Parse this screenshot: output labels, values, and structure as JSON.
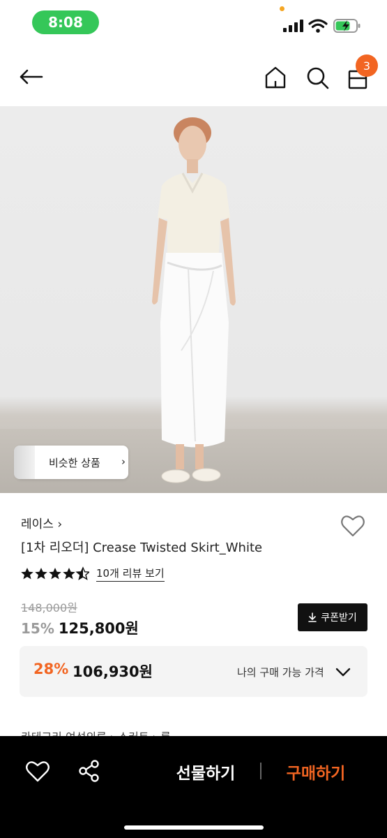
{
  "status_bar": {
    "time": "8:08"
  },
  "nav": {
    "cart_count": "3"
  },
  "hero": {
    "similar_label": "비슷한 상품",
    "similar_chevron": "›"
  },
  "product": {
    "brand": "레이스 ›",
    "title": "[1차 리오더] Crease Twisted Skirt_White",
    "rating": 4.5,
    "review_link": "10개 리뷰 보기",
    "original_price": "148,000원",
    "discount_pct": "15%",
    "sale_price": "125,800원",
    "coupon_label": "쿠폰받기"
  },
  "my_price": {
    "pct": "28%",
    "price": "106,930원",
    "label": "나의 구매 가능 가격"
  },
  "category": {
    "text": "카테고리      여성의류 › 스커트 › 롱"
  },
  "bottom_bar": {
    "gift_label": "선물하기",
    "buy_label": "구매하기"
  },
  "colors": {
    "accent": "#f26522",
    "status_green": "#35c759"
  },
  "icons": [
    "back-arrow-icon",
    "home-icon",
    "search-icon",
    "bag-icon",
    "heart-icon",
    "share-icon",
    "download-icon",
    "chevron-down-icon"
  ]
}
